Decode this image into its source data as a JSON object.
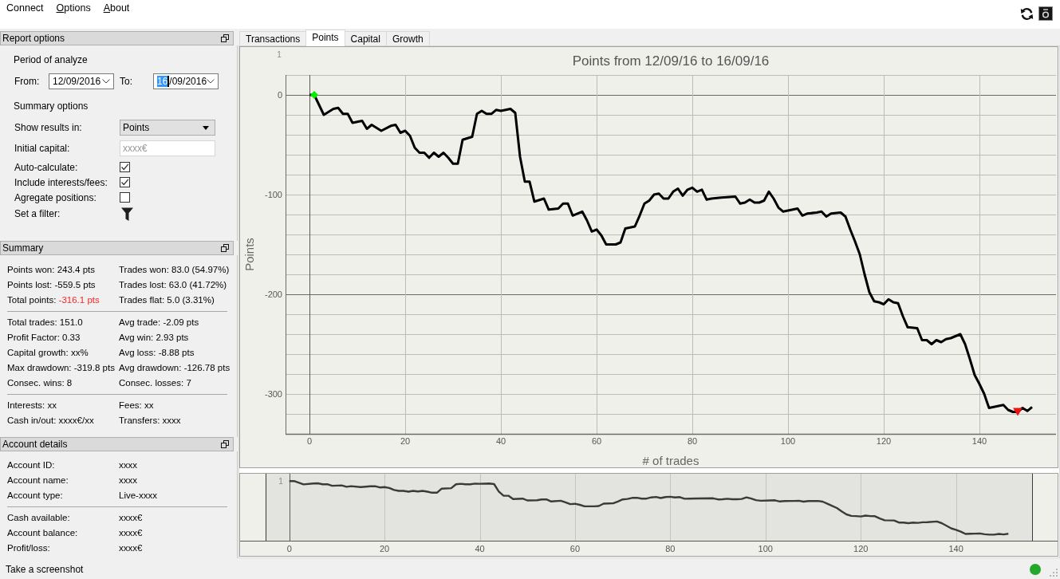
{
  "menu": [
    {
      "label": "Connect",
      "mnemonic": false
    },
    {
      "label": "Options",
      "mnemonic": true
    },
    {
      "label": "About",
      "mnemonic": true
    }
  ],
  "report_options": {
    "title": "Report options",
    "period": {
      "heading": "Period of analyze",
      "from_label": "From:",
      "from_date": {
        "segments": [
          {
            "text": "12/09/2016",
            "selected": false
          }
        ]
      },
      "to_label": "To:",
      "to_date": {
        "segments": [
          {
            "text": "16",
            "selected": true
          },
          {
            "text": "/09/2016",
            "selected": false
          }
        ]
      }
    },
    "summary_options": {
      "heading": "Summary options",
      "rows": [
        {
          "kind": "select",
          "label": "Show results in:",
          "value": "Points"
        },
        {
          "kind": "input",
          "label": "Initial capital:",
          "placeholder": "xxxx€"
        },
        {
          "kind": "checkbox",
          "label": "Auto-calculate:",
          "checked": true
        },
        {
          "kind": "checkbox",
          "label": "Include interests/fees:",
          "checked": true
        },
        {
          "kind": "checkbox",
          "label": "Agregate positions:",
          "checked": false
        },
        {
          "kind": "filter",
          "label": "Set a filter:"
        }
      ]
    }
  },
  "summary": {
    "title": "Summary",
    "sections": [
      [
        {
          "label": "Points won:",
          "value": "243.4 pts",
          "alert": false
        },
        {
          "label": "Trades won:",
          "value": "83.0 (54.97%)",
          "alert": false
        },
        {
          "label": "Points lost:",
          "value": "-559.5 pts",
          "alert": false
        },
        {
          "label": "Trades lost:",
          "value": "63.0 (41.72%)",
          "alert": false
        },
        {
          "label": "Total points:",
          "value": "-316.1 pts",
          "alert": true
        },
        {
          "label": "Trades flat:",
          "value": "5.0 (3.31%)",
          "alert": false
        }
      ],
      [
        {
          "label": "Total trades:",
          "value": "151.0",
          "alert": false
        },
        {
          "label": "Avg trade:",
          "value": "-2.09 pts",
          "alert": false
        },
        {
          "label": "Profit Factor:",
          "value": "0.33",
          "alert": false
        },
        {
          "label": "Avg win:",
          "value": "2.93 pts",
          "alert": false
        },
        {
          "label": "Capital growth:",
          "value": "xx%",
          "alert": false
        },
        {
          "label": "Avg loss:",
          "value": "-8.88 pts",
          "alert": false
        },
        {
          "label": "Max drawdown:",
          "value": "-319.8 pts",
          "alert": false
        },
        {
          "label": "Avg drawdown:",
          "value": "-126.78 pts",
          "alert": false
        },
        {
          "label": "Consec. wins:",
          "value": "8",
          "alert": false
        },
        {
          "label": "Consec. losses:",
          "value": "7",
          "alert": false
        }
      ],
      [
        {
          "label": "Interests:",
          "value": "xx",
          "alert": false
        },
        {
          "label": "Fees:",
          "value": "xx",
          "alert": false
        },
        {
          "label": "Cash in/out:",
          "value": "xxxx€/xx",
          "alert": false
        },
        {
          "label": "Transfers:",
          "value": "xxxx",
          "alert": false
        }
      ]
    ]
  },
  "account_details": {
    "title": "Account details",
    "sections": [
      [
        {
          "label": "Account ID:",
          "value": "xxxx"
        },
        {
          "label": "Account name:",
          "value": "xxxx"
        },
        {
          "label": "Account type:",
          "value": "Live-xxxx"
        }
      ],
      [
        {
          "label": "Cash available:",
          "value": "xxxx€"
        },
        {
          "label": "Account balance:",
          "value": "xxxx€"
        },
        {
          "label": "Profit/loss:",
          "value": "xxxx€"
        }
      ]
    ]
  },
  "tabs": [
    {
      "label": "Transactions",
      "selected": false
    },
    {
      "label": "Points",
      "selected": true
    },
    {
      "label": "Capital",
      "selected": false
    },
    {
      "label": "Growth",
      "selected": false
    }
  ],
  "points_chart": {
    "chart_data": {
      "type": "line",
      "title": "Points from 12/09/16 to 16/09/16",
      "xlabel": "# of trades",
      "ylabel": "Points",
      "xlim": [
        -5,
        156
      ],
      "ylim": [
        -340,
        20
      ],
      "xticks": [
        0,
        20,
        40,
        60,
        80,
        100,
        120,
        140
      ],
      "yticks": [
        0,
        -100,
        -200,
        -300
      ],
      "grid": true,
      "annotations": [
        "1"
      ],
      "series": [
        {
          "type": "line",
          "color": "#000000",
          "x": [
            0,
            1,
            3,
            5,
            6,
            7,
            8,
            9,
            10,
            11,
            12,
            13,
            15,
            17,
            18,
            19,
            20,
            21,
            22,
            23,
            24,
            25,
            26,
            27,
            28,
            29,
            30,
            31,
            32,
            34,
            35,
            36,
            37,
            38,
            39,
            40,
            42,
            43,
            44,
            45,
            46,
            47,
            49,
            50,
            52,
            53,
            54,
            55,
            57,
            58,
            59,
            60,
            61,
            62,
            64,
            65,
            66,
            68,
            69,
            70,
            71,
            72,
            73,
            74,
            75,
            76,
            77,
            78,
            79,
            80,
            81,
            82,
            83,
            84,
            86,
            89,
            90,
            91,
            92,
            93,
            94,
            95,
            96,
            97,
            98,
            99,
            101,
            102,
            103,
            104,
            106,
            107,
            108,
            109,
            111,
            112,
            113,
            114,
            115,
            116,
            117,
            118,
            119,
            120,
            121,
            122,
            123,
            124,
            125,
            127,
            128,
            129,
            130,
            131,
            132,
            133,
            134,
            136,
            137,
            138,
            139,
            140,
            141,
            142,
            143,
            144,
            145,
            146,
            147,
            148,
            149,
            150,
            151
          ],
          "values": [
            0,
            0,
            -20,
            -14,
            -13,
            -19,
            -19,
            -28,
            -27,
            -26,
            -34,
            -30,
            -36,
            -31,
            -30,
            -38,
            -36,
            -41,
            -53,
            -58,
            -58,
            -63,
            -58,
            -62,
            -58,
            -63,
            -69,
            -69,
            -45,
            -42,
            -19,
            -16,
            -19,
            -19,
            -15,
            -16,
            -14,
            -18,
            -62,
            -87,
            -87,
            -107,
            -104,
            -115,
            -114,
            -109,
            -109,
            -121,
            -117,
            -126,
            -137,
            -135,
            -141,
            -150,
            -150,
            -148,
            -134,
            -132,
            -121,
            -109,
            -106,
            -100,
            -99,
            -104,
            -104,
            -97,
            -94,
            -101,
            -95,
            -93,
            -97,
            -95,
            -105,
            -104,
            -103,
            -102,
            -109,
            -108,
            -105,
            -108,
            -108,
            -106,
            -97,
            -104,
            -113,
            -117,
            -115,
            -114,
            -121,
            -119,
            -118,
            -117,
            -122,
            -119,
            -118,
            -122,
            -135,
            -147,
            -160,
            -180,
            -198,
            -207,
            -208,
            -210,
            -205,
            -208,
            -209,
            -222,
            -233,
            -234,
            -246,
            -246,
            -250,
            -246,
            -248,
            -245,
            -244,
            -240,
            -250,
            -265,
            -281,
            -290,
            -300,
            -314,
            -313,
            -312,
            -311,
            -316,
            -318,
            -318,
            -314,
            -317,
            -313
          ]
        },
        {
          "type": "scatter",
          "marker": "diamond",
          "color": "#00ee00",
          "x": [
            1
          ],
          "values": [
            0
          ]
        },
        {
          "type": "scatter",
          "marker": "triangle-down",
          "color": "#ee1111",
          "x": [
            148
          ],
          "values": [
            -318
          ]
        }
      ]
    }
  },
  "overview": {
    "corner_label": "1",
    "x_tick_labels": [
      "0",
      "20",
      "40",
      "60",
      "80",
      "100",
      "120",
      "140"
    ]
  },
  "status_bar": {
    "message": "Take a screenshot",
    "connected": true
  }
}
